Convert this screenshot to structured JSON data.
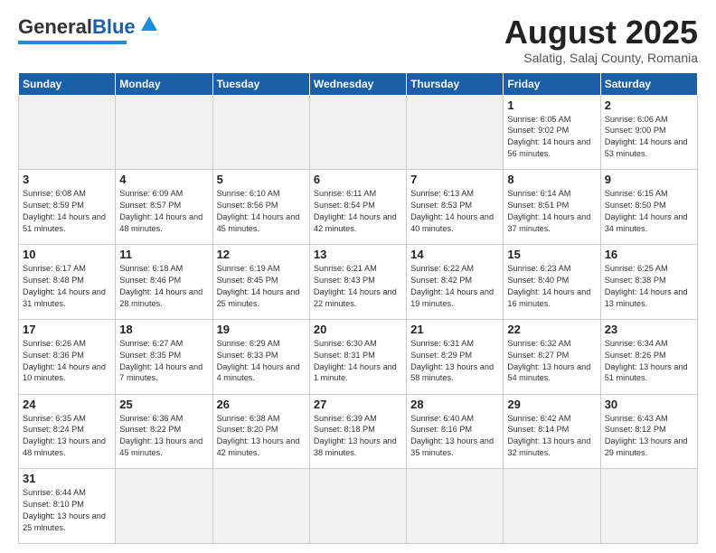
{
  "header": {
    "logo_general": "General",
    "logo_blue": "Blue",
    "month_year": "August 2025",
    "location": "Salatig, Salaj County, Romania"
  },
  "days_of_week": [
    "Sunday",
    "Monday",
    "Tuesday",
    "Wednesday",
    "Thursday",
    "Friday",
    "Saturday"
  ],
  "weeks": [
    [
      {
        "day": "",
        "info": "",
        "empty": true
      },
      {
        "day": "",
        "info": "",
        "empty": true
      },
      {
        "day": "",
        "info": "",
        "empty": true
      },
      {
        "day": "",
        "info": "",
        "empty": true
      },
      {
        "day": "",
        "info": "",
        "empty": true
      },
      {
        "day": "1",
        "info": "Sunrise: 6:05 AM\nSunset: 9:02 PM\nDaylight: 14 hours and 56 minutes."
      },
      {
        "day": "2",
        "info": "Sunrise: 6:06 AM\nSunset: 9:00 PM\nDaylight: 14 hours and 53 minutes."
      }
    ],
    [
      {
        "day": "3",
        "info": "Sunrise: 6:08 AM\nSunset: 8:59 PM\nDaylight: 14 hours and 51 minutes."
      },
      {
        "day": "4",
        "info": "Sunrise: 6:09 AM\nSunset: 8:57 PM\nDaylight: 14 hours and 48 minutes."
      },
      {
        "day": "5",
        "info": "Sunrise: 6:10 AM\nSunset: 8:56 PM\nDaylight: 14 hours and 45 minutes."
      },
      {
        "day": "6",
        "info": "Sunrise: 6:11 AM\nSunset: 8:54 PM\nDaylight: 14 hours and 42 minutes."
      },
      {
        "day": "7",
        "info": "Sunrise: 6:13 AM\nSunset: 8:53 PM\nDaylight: 14 hours and 40 minutes."
      },
      {
        "day": "8",
        "info": "Sunrise: 6:14 AM\nSunset: 8:51 PM\nDaylight: 14 hours and 37 minutes."
      },
      {
        "day": "9",
        "info": "Sunrise: 6:15 AM\nSunset: 8:50 PM\nDaylight: 14 hours and 34 minutes."
      }
    ],
    [
      {
        "day": "10",
        "info": "Sunrise: 6:17 AM\nSunset: 8:48 PM\nDaylight: 14 hours and 31 minutes."
      },
      {
        "day": "11",
        "info": "Sunrise: 6:18 AM\nSunset: 8:46 PM\nDaylight: 14 hours and 28 minutes."
      },
      {
        "day": "12",
        "info": "Sunrise: 6:19 AM\nSunset: 8:45 PM\nDaylight: 14 hours and 25 minutes."
      },
      {
        "day": "13",
        "info": "Sunrise: 6:21 AM\nSunset: 8:43 PM\nDaylight: 14 hours and 22 minutes."
      },
      {
        "day": "14",
        "info": "Sunrise: 6:22 AM\nSunset: 8:42 PM\nDaylight: 14 hours and 19 minutes."
      },
      {
        "day": "15",
        "info": "Sunrise: 6:23 AM\nSunset: 8:40 PM\nDaylight: 14 hours and 16 minutes."
      },
      {
        "day": "16",
        "info": "Sunrise: 6:25 AM\nSunset: 8:38 PM\nDaylight: 14 hours and 13 minutes."
      }
    ],
    [
      {
        "day": "17",
        "info": "Sunrise: 6:26 AM\nSunset: 8:36 PM\nDaylight: 14 hours and 10 minutes."
      },
      {
        "day": "18",
        "info": "Sunrise: 6:27 AM\nSunset: 8:35 PM\nDaylight: 14 hours and 7 minutes."
      },
      {
        "day": "19",
        "info": "Sunrise: 6:29 AM\nSunset: 8:33 PM\nDaylight: 14 hours and 4 minutes."
      },
      {
        "day": "20",
        "info": "Sunrise: 6:30 AM\nSunset: 8:31 PM\nDaylight: 14 hours and 1 minute."
      },
      {
        "day": "21",
        "info": "Sunrise: 6:31 AM\nSunset: 8:29 PM\nDaylight: 13 hours and 58 minutes."
      },
      {
        "day": "22",
        "info": "Sunrise: 6:32 AM\nSunset: 8:27 PM\nDaylight: 13 hours and 54 minutes."
      },
      {
        "day": "23",
        "info": "Sunrise: 6:34 AM\nSunset: 8:26 PM\nDaylight: 13 hours and 51 minutes."
      }
    ],
    [
      {
        "day": "24",
        "info": "Sunrise: 6:35 AM\nSunset: 8:24 PM\nDaylight: 13 hours and 48 minutes."
      },
      {
        "day": "25",
        "info": "Sunrise: 6:36 AM\nSunset: 8:22 PM\nDaylight: 13 hours and 45 minutes."
      },
      {
        "day": "26",
        "info": "Sunrise: 6:38 AM\nSunset: 8:20 PM\nDaylight: 13 hours and 42 minutes."
      },
      {
        "day": "27",
        "info": "Sunrise: 6:39 AM\nSunset: 8:18 PM\nDaylight: 13 hours and 38 minutes."
      },
      {
        "day": "28",
        "info": "Sunrise: 6:40 AM\nSunset: 8:16 PM\nDaylight: 13 hours and 35 minutes."
      },
      {
        "day": "29",
        "info": "Sunrise: 6:42 AM\nSunset: 8:14 PM\nDaylight: 13 hours and 32 minutes."
      },
      {
        "day": "30",
        "info": "Sunrise: 6:43 AM\nSunset: 8:12 PM\nDaylight: 13 hours and 29 minutes."
      }
    ],
    [
      {
        "day": "31",
        "info": "Sunrise: 6:44 AM\nSunset: 8:10 PM\nDaylight: 13 hours and 25 minutes."
      },
      {
        "day": "",
        "info": "",
        "empty": true
      },
      {
        "day": "",
        "info": "",
        "empty": true
      },
      {
        "day": "",
        "info": "",
        "empty": true
      },
      {
        "day": "",
        "info": "",
        "empty": true
      },
      {
        "day": "",
        "info": "",
        "empty": true
      },
      {
        "day": "",
        "info": "",
        "empty": true
      }
    ]
  ]
}
